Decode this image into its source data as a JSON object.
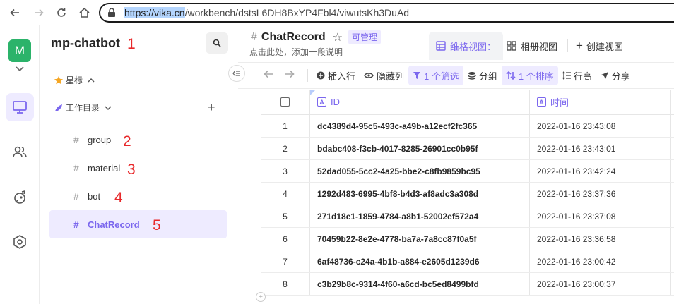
{
  "browser": {
    "url_selected": "https://vika.cn",
    "url_rest": "/workbench/dstsL6DH8BxYP4Fbl4/viwutsKh3DuAd"
  },
  "rail": {
    "avatar_letter": "M"
  },
  "sidebar": {
    "space_name": "mp-chatbot",
    "annotations": [
      "1",
      "2",
      "3",
      "4",
      "5"
    ],
    "starred_label": "星标",
    "workdir_label": "工作目录",
    "nodes": [
      {
        "label": "group"
      },
      {
        "label": "material"
      },
      {
        "label": "bot"
      },
      {
        "label": "ChatRecord"
      }
    ]
  },
  "header": {
    "title": "ChatRecord",
    "permission": "可管理",
    "description": "点击此处，添加一段说明",
    "views": [
      "维格视图：",
      "相册视图",
      "创建视图"
    ]
  },
  "toolbar": {
    "insert_row": "插入行",
    "hide_columns": "隐藏列",
    "filter": "1 个筛选",
    "group": "分组",
    "sort": "1 个排序",
    "row_height": "行高",
    "share": "分享"
  },
  "table": {
    "columns": [
      "ID",
      "时间"
    ],
    "rows": [
      {
        "idx": "1",
        "id": "dc4389d4-95c5-493c-a49b-a12ecf2fc365",
        "time": "2022-01-16 23:43:08"
      },
      {
        "idx": "2",
        "id": "bdabc408-f3cb-4017-8285-26901cc0b95f",
        "time": "2022-01-16 23:43:01"
      },
      {
        "idx": "3",
        "id": "52dad055-5cc2-4a25-bbe2-c8fb9859bc95",
        "time": "2022-01-16 23:42:24"
      },
      {
        "idx": "4",
        "id": "1292d483-6995-4bf8-b4d3-af8adc3a308d",
        "time": "2022-01-16 23:37:36"
      },
      {
        "idx": "5",
        "id": "271d18e1-1859-4784-a8b1-52002ef572a4",
        "time": "2022-01-16 23:37:08"
      },
      {
        "idx": "6",
        "id": "70459b22-8e2e-4778-ba7a-7a8cc87f0a5f",
        "time": "2022-01-16 23:36:58"
      },
      {
        "idx": "7",
        "id": "6af48736-c24a-4b1b-a884-e2605d1239d6",
        "time": "2022-01-16 23:00:42"
      },
      {
        "idx": "8",
        "id": "c3b29b8c-9314-4f60-a6cd-bc5ed8499bfd",
        "time": "2022-01-16 23:00:37"
      }
    ]
  },
  "colors": {
    "accent": "#7b67ee",
    "accent_bg": "#eeebff",
    "annotation_red": "#e8292b",
    "avatar_green": "#2bb36a"
  }
}
